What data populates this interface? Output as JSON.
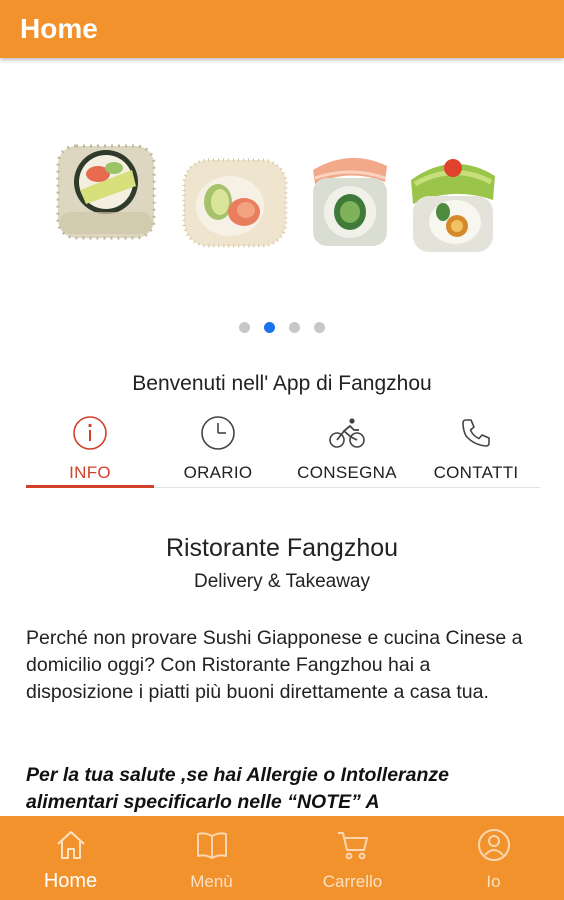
{
  "app_bar": {
    "title": "Home"
  },
  "carousel": {
    "slides_count": 4,
    "active_index": 1
  },
  "welcome_text": "Benvenuti nell' App di Fangzhou",
  "tabs": [
    {
      "label": "INFO",
      "icon": "info-icon",
      "active": true
    },
    {
      "label": "ORARIO",
      "icon": "clock-icon",
      "active": false
    },
    {
      "label": "CONSEGNA",
      "icon": "bicycle-icon",
      "active": false
    },
    {
      "label": "CONTATTI",
      "icon": "phone-icon",
      "active": false
    }
  ],
  "content": {
    "restaurant_name": "Ristorante Fangzhou",
    "subtitle": "Delivery & Takeaway",
    "description": "Perché non provare Sushi Giapponese e cucina Cinese a domicilio oggi? Con Ristorante Fangzhou hai a disposizione i piatti più buoni direttamente a casa tua.",
    "allergy_note": "Per la tua salute ,se hai Allergie o Intolleranze alimentari specificarlo nelle “NOTE” A"
  },
  "bottom_nav": [
    {
      "label": "Home",
      "icon": "home-icon",
      "active": true
    },
    {
      "label": "Menù",
      "icon": "book-icon",
      "active": false
    },
    {
      "label": "Carrello",
      "icon": "cart-icon",
      "active": false
    },
    {
      "label": "Io",
      "icon": "user-icon",
      "active": false
    }
  ],
  "colors": {
    "primary": "#f2922d",
    "active_tab": "#d2402a",
    "active_dot": "#1a73e8",
    "inactive_dot": "#c7c7c7",
    "inactive_nav_label": "#fbe1c4"
  }
}
